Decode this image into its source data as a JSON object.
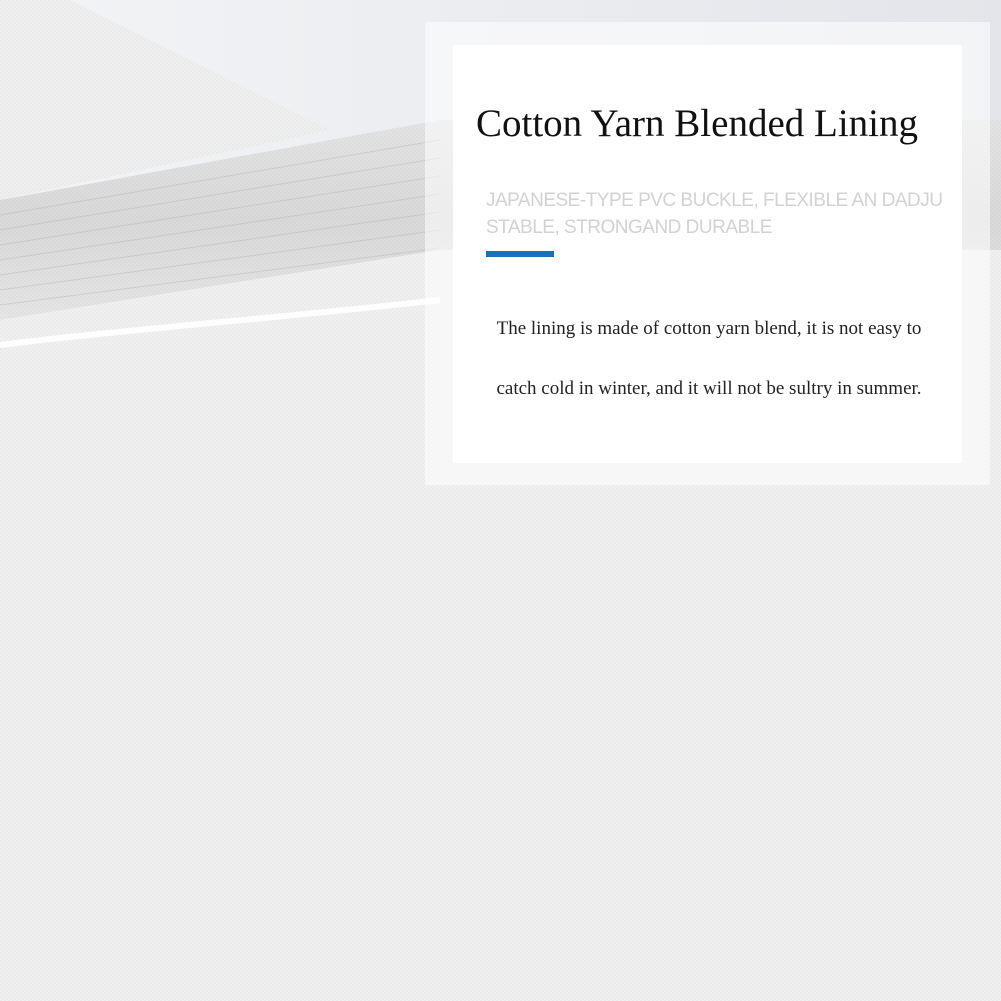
{
  "card": {
    "title": "Cotton Yarn Blended Lining",
    "subtitle": "JAPANESE-TYPE PVC BUCKLE, FLEXIBLE AN DADJUSTABLE, STRONGAND DURABLE",
    "body_lines": [
      "The lining is made of cotton yarn blend, it is not easy to",
      "catch cold in winter, and it will not be sultry in summer."
    ],
    "accent_color": "#1a6fc0"
  }
}
